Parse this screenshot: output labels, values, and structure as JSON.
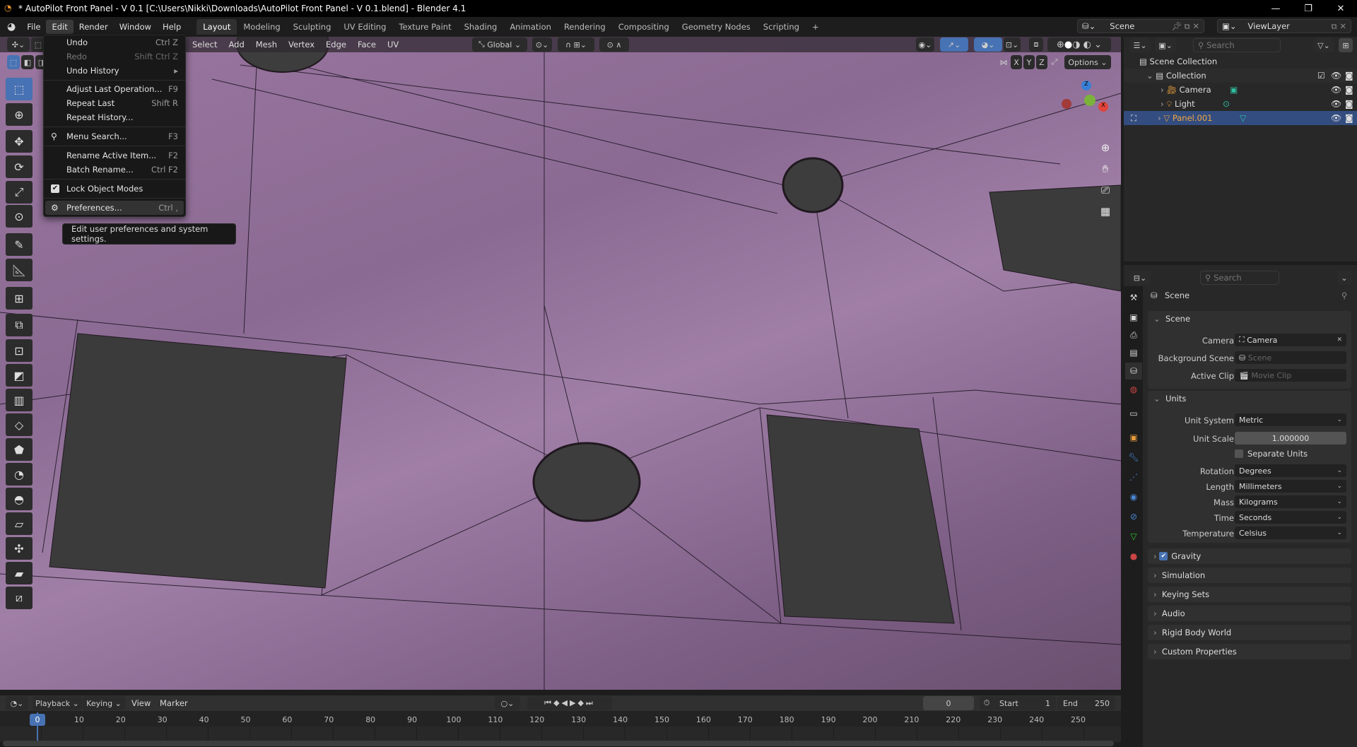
{
  "window": {
    "title": "* AutoPilot Front Panel - V 0.1 [C:\\Users\\Nikki\\Downloads\\AutoPilot Front Panel - V 0.1.blend] - Blender 4.1",
    "minimize": "—",
    "maximize": "❐",
    "close": "✕"
  },
  "menubar": {
    "items": [
      "File",
      "Edit",
      "Render",
      "Window",
      "Help"
    ],
    "active": "Edit"
  },
  "workspaces": {
    "tabs": [
      "Layout",
      "Modeling",
      "Sculpting",
      "UV Editing",
      "Texture Paint",
      "Shading",
      "Animation",
      "Rendering",
      "Compositing",
      "Geometry Nodes",
      "Scripting"
    ],
    "active": "Layout",
    "add": "+"
  },
  "scene_selector": {
    "value": "Scene"
  },
  "viewlayer_selector": {
    "value": "ViewLayer"
  },
  "viewport_header": {
    "menus": [
      "Select",
      "Add",
      "Mesh",
      "Vertex",
      "Edge",
      "Face",
      "UV"
    ],
    "orientation": "Global",
    "options": "Options",
    "axes": [
      "X",
      "Y",
      "Z"
    ]
  },
  "edit_menu": {
    "items": [
      {
        "label": "Undo",
        "shortcut": "Ctrl Z",
        "enabled": true
      },
      {
        "label": "Redo",
        "shortcut": "Shift Ctrl Z",
        "enabled": false
      },
      {
        "label": "Undo History",
        "shortcut": "▸",
        "enabled": true
      },
      {
        "label": "Adjust Last Operation...",
        "shortcut": "F9",
        "enabled": true
      },
      {
        "label": "Repeat Last",
        "shortcut": "Shift R",
        "enabled": true
      },
      {
        "label": "Repeat History...",
        "shortcut": "",
        "enabled": true
      },
      {
        "label": "Menu Search...",
        "shortcut": "F3",
        "enabled": true,
        "icon": "search-icon"
      },
      {
        "label": "Rename Active Item...",
        "shortcut": "F2",
        "enabled": true
      },
      {
        "label": "Batch Rename...",
        "shortcut": "Ctrl F2",
        "enabled": true
      },
      {
        "label": "Lock Object Modes",
        "shortcut": "",
        "enabled": true,
        "checked": true
      },
      {
        "label": "Preferences...",
        "shortcut": "Ctrl ,",
        "enabled": true,
        "icon": "gear-icon",
        "highlighted": true
      }
    ]
  },
  "tooltip": {
    "text": "Edit user preferences and system settings."
  },
  "outliner": {
    "search_placeholder": "Search",
    "root": "Scene Collection",
    "items": [
      {
        "label": "Collection",
        "level": 0
      },
      {
        "label": "Camera",
        "level": 1
      },
      {
        "label": "Light",
        "level": 1
      },
      {
        "label": "Panel.001",
        "level": 1,
        "selected": true
      }
    ]
  },
  "properties": {
    "search_placeholder": "Search",
    "context": "Scene",
    "scene_panel": {
      "title": "Scene",
      "camera_label": "Camera",
      "camera": "Camera",
      "background_label": "Background Scene",
      "background_placeholder": "Scene",
      "clip_label": "Active Clip",
      "clip_placeholder": "Movie Clip"
    },
    "units_panel": {
      "title": "Units",
      "rows": [
        {
          "label": "Unit System",
          "value": "Metric"
        },
        {
          "label": "Unit Scale",
          "value": "1.000000"
        },
        {
          "label": "Rotation",
          "value": "Degrees"
        },
        {
          "label": "Length",
          "value": "Millimeters"
        },
        {
          "label": "Mass",
          "value": "Kilograms"
        },
        {
          "label": "Time",
          "value": "Seconds"
        },
        {
          "label": "Temperature",
          "value": "Celsius"
        }
      ],
      "separate_units": "Separate Units",
      "separate_units_checked": false
    },
    "collapsed_panels": [
      "Gravity",
      "Simulation",
      "Keying Sets",
      "Audio",
      "Rigid Body World",
      "Custom Properties"
    ],
    "gravity_checked": true
  },
  "timeline": {
    "menus": [
      "Playback",
      "Keying",
      "View",
      "Marker"
    ],
    "current_frame": "0",
    "start_label": "Start",
    "start": "1",
    "end_label": "End",
    "end": "250",
    "ticks": [
      "0",
      "10",
      "20",
      "30",
      "40",
      "50",
      "60",
      "70",
      "80",
      "90",
      "100",
      "110",
      "120",
      "130",
      "140",
      "150",
      "160",
      "170",
      "180",
      "190",
      "200",
      "210",
      "220",
      "230",
      "240",
      "250"
    ]
  },
  "colors": {
    "accent": "#4772b3",
    "mesh": "#9a76a0",
    "selected_row": "#334d80",
    "object_orange": "#e59b3c"
  }
}
